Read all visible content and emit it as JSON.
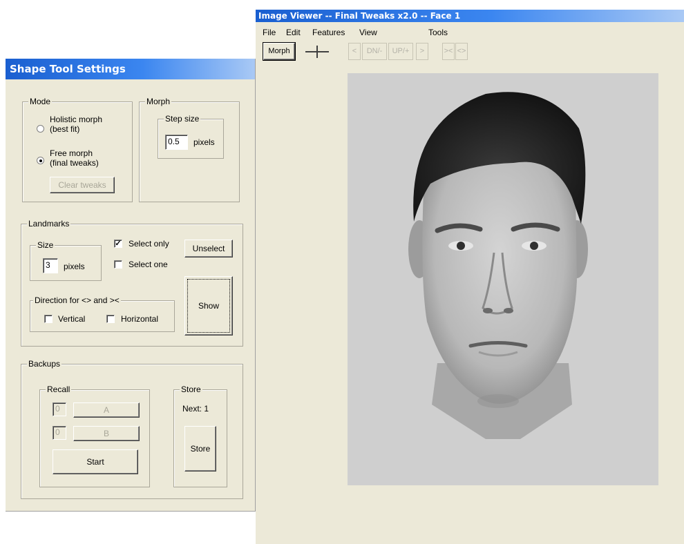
{
  "viewer": {
    "title": "Image Viewer -- Final Tweaks x2.0 -- Face 1",
    "menu": [
      "File",
      "Edit",
      "Features",
      "View",
      "Tools"
    ],
    "toolbar": {
      "morph": "Morph",
      "prev": "<",
      "down": "DN/-",
      "up": "UP/+",
      "next": ">",
      "narrow": "><",
      "widen": "<>"
    }
  },
  "shape_tool": {
    "title": "Shape Tool Settings",
    "mode": {
      "legend": "Mode",
      "holistic_line1": "Holistic morph",
      "holistic_line2": "(best fit)",
      "free_line1": "Free morph",
      "free_line2": "(final tweaks)",
      "clear_tweaks": "Clear tweaks",
      "selected": "free"
    },
    "morph": {
      "legend": "Morph",
      "step_legend": "Step size",
      "step_value": "0.5",
      "step_unit": "pixels"
    },
    "landmarks": {
      "legend": "Landmarks",
      "size_legend": "Size",
      "size_value": "3",
      "size_unit": "pixels",
      "select_only": "Select only",
      "select_only_checked": true,
      "select_one": "Select one",
      "select_one_checked": false,
      "unselect": "Unselect",
      "show": "Show",
      "direction_legend": "Direction for <> and ><",
      "vertical": "Vertical",
      "horizontal": "Horizontal"
    },
    "backups": {
      "legend": "Backups",
      "recall_legend": "Recall",
      "a_count": "0",
      "a_label": "A",
      "b_count": "0",
      "b_label": "B",
      "start": "Start",
      "store_legend": "Store",
      "next": "Next: 1",
      "store": "Store"
    }
  }
}
